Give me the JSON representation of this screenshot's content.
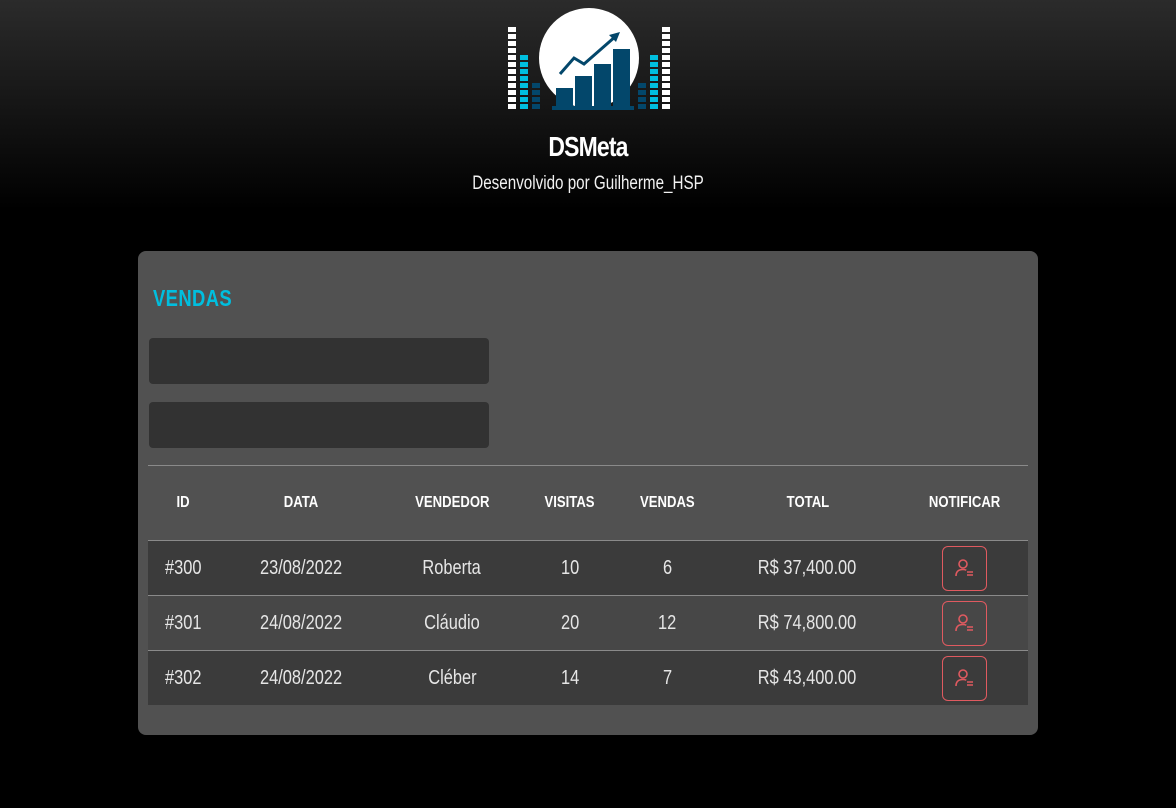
{
  "app": {
    "title": "DSMeta",
    "subtitle": "Desenvolvido por Guilherme_HSP"
  },
  "logo": {
    "icon": "rising-bar-chart-logo",
    "colors": {
      "dark": "#03476b",
      "cyan": "#00bfdf",
      "white": "#ffffff"
    }
  },
  "card": {
    "title": "VENDAS",
    "filters": [
      {
        "name": "min-date",
        "value": "",
        "placeholder": ""
      },
      {
        "name": "max-date",
        "value": "",
        "placeholder": ""
      }
    ]
  },
  "table": {
    "headers": [
      "ID",
      "DATA",
      "VENDEDOR",
      "VISITAS",
      "VENDAS",
      "TOTAL",
      "NOTIFICAR"
    ],
    "rows": [
      {
        "id": "#300",
        "date": "23/08/2022",
        "seller": "Roberta",
        "visits": "10",
        "deals": "6",
        "total": "R$ 37,400.00"
      },
      {
        "id": "#301",
        "date": "24/08/2022",
        "seller": "Cláudio",
        "visits": "20",
        "deals": "12",
        "total": "R$ 74,800.00"
      },
      {
        "id": "#302",
        "date": "24/08/2022",
        "seller": "Cléber",
        "visits": "14",
        "deals": "7",
        "total": "R$ 43,400.00"
      }
    ],
    "notify_icon": "notify-user-icon"
  },
  "colors": {
    "accent": "#00bfdf",
    "card": "#515151",
    "input": "#323232",
    "notify": "#e05a60"
  }
}
